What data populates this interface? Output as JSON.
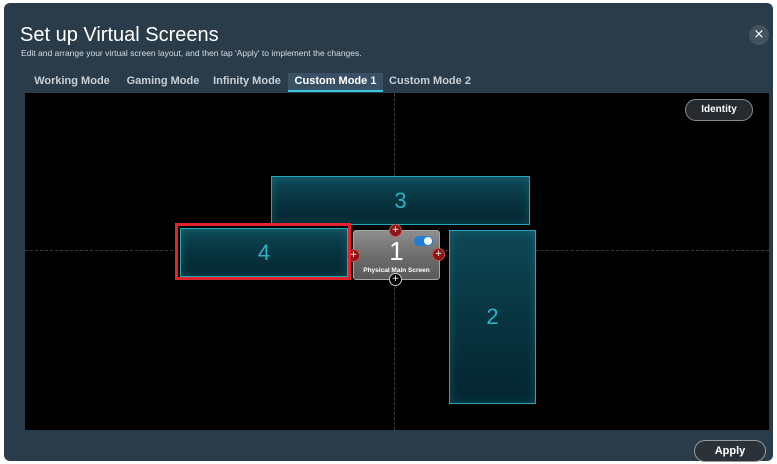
{
  "dialog": {
    "title": "Set up Virtual Screens",
    "subtitle": "Edit and arrange your virtual screen layout, and then tap 'Apply' to implement the changes.",
    "close_glyph": "×"
  },
  "tabs": [
    {
      "label": "Working Mode",
      "active": false
    },
    {
      "label": "Gaming Mode",
      "active": false
    },
    {
      "label": "Infinity Mode",
      "active": false
    },
    {
      "label": "Custom Mode 1",
      "active": true
    },
    {
      "label": "Custom Mode 2",
      "active": false
    }
  ],
  "canvas": {
    "identity_label": "Identity",
    "physical_screen": {
      "number": "1",
      "label": "Physical Main Screen",
      "toggle_on": true
    },
    "virtual_screens": [
      {
        "number": "3"
      },
      {
        "number": "4",
        "highlighted": true
      },
      {
        "number": "2"
      }
    ],
    "handle_glyphs": {
      "add": "+"
    }
  },
  "footer": {
    "apply_label": "Apply"
  },
  "colors": {
    "dialog_bg": "#2a3c4a",
    "accent_teal": "#35c6d8",
    "virtual_screen_border": "#27a6ba",
    "highlight_red": "#e0242a",
    "toggle_blue": "#1f7fd6",
    "handle_red": "#8b1414"
  },
  "icons": {
    "close": "close-icon",
    "add_handle": "plus-icon",
    "toggle": "toggle-switch"
  }
}
